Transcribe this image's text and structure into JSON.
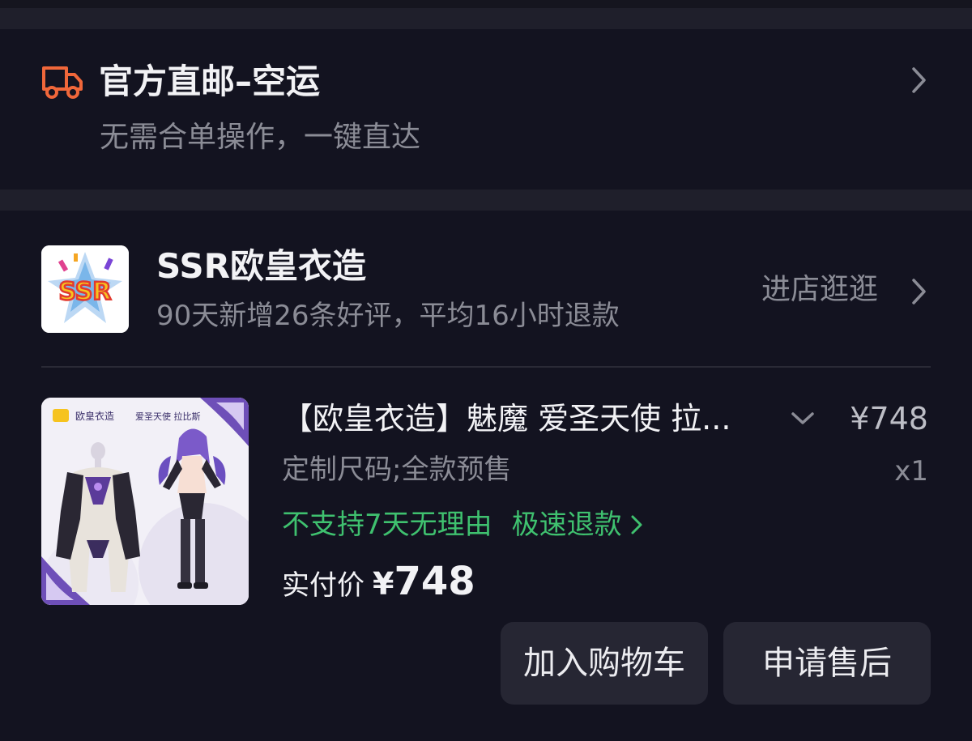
{
  "shipping": {
    "icon": "truck-icon",
    "icon_color": "#f0673a",
    "title": "官方直邮–空运",
    "subtitle": "无需合单操作，一键直达"
  },
  "store": {
    "logo_text": "SSR",
    "name": "SSR欧皇衣造",
    "stats": "90天新增26条好评，平均16小时退款",
    "visit_label": "进店逛逛"
  },
  "product": {
    "image_caption_brand": "欧皇衣造",
    "image_caption_name": "爱圣天使 拉比斯",
    "title": "【欧皇衣造】魅魔 爱圣天使 拉...",
    "price": "¥748",
    "spec": "定制尺码;全款预售",
    "quantity": "x1",
    "policy_return": "不支持7天无理由",
    "policy_refund": "极速退款",
    "paid_label": "实付价",
    "paid_currency": "¥",
    "paid_amount": "748"
  },
  "actions": {
    "add_to_cart": "加入购物车",
    "after_sales": "申请售后"
  },
  "colors": {
    "background": "#161622",
    "card": "#131320",
    "accent_green": "#3fc16f",
    "accent_orange": "#f0673a"
  }
}
